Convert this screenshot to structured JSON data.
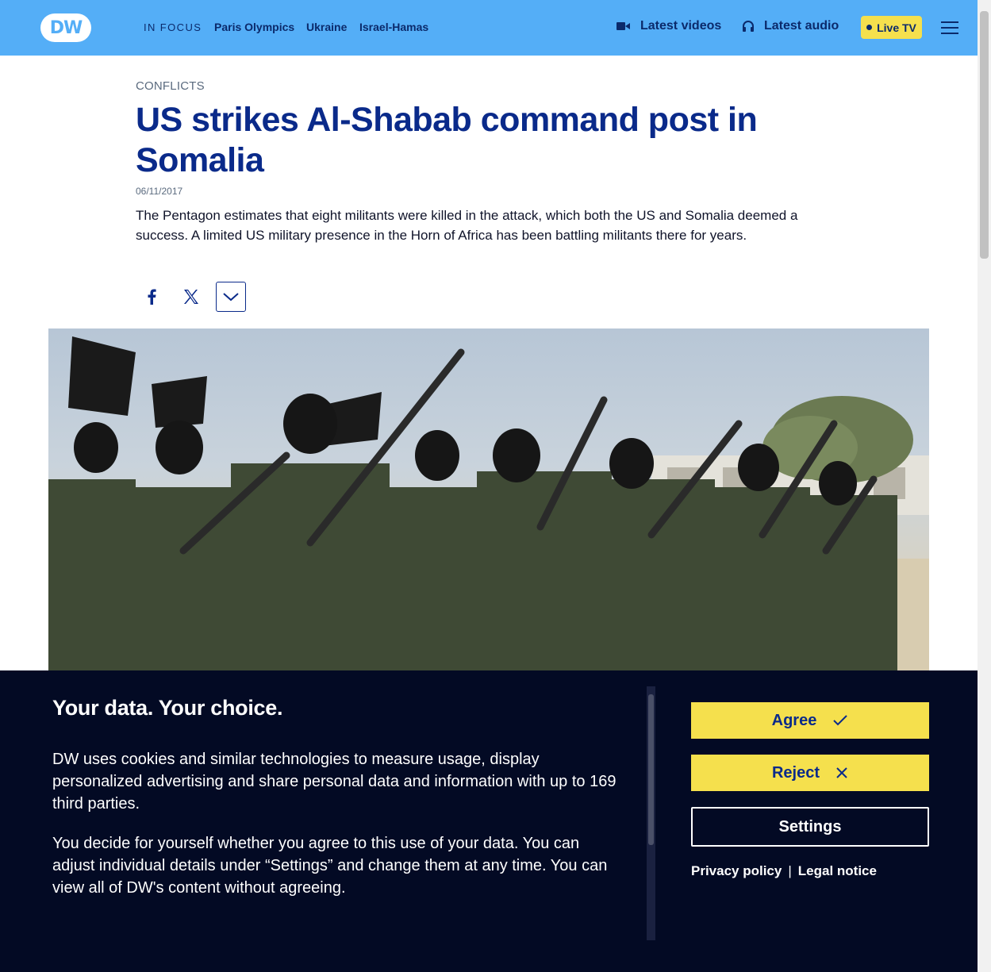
{
  "header": {
    "logo_text": "DW",
    "in_focus_label": "IN FOCUS",
    "focus_links": [
      "Paris Olympics",
      "Ukraine",
      "Israel-Hamas"
    ],
    "latest_videos": "Latest videos",
    "latest_audio": "Latest audio",
    "live_tv": "Live TV",
    "colors": {
      "bar": "#54aef7",
      "text": "#0b2a6b",
      "live_bg": "#f5e04d"
    }
  },
  "article": {
    "category": "CONFLICTS",
    "title": "US strikes Al-Shabab command post in Somalia",
    "date": "06/11/2017",
    "teaser": "The Pentagon estimates that eight militants were killed in the attack, which both the US and Somalia deemed a success. A limited US military presence in the Horn of Africa has been battling militants there for years.",
    "share_icons": [
      "facebook-icon",
      "x-icon",
      "chevron-down-icon"
    ],
    "hero_image": "photo-of-armed-militants-marching"
  },
  "cookie_banner": {
    "title": "Your data. Your choice.",
    "paragraph_1": "DW uses cookies and similar technologies to measure usage, display personalized advertising and share personal data and information with up to 169 third parties.",
    "paragraph_2": "You decide for yourself whether you agree to this use of your data. You can adjust individual details under “Settings” and change them at any time. You can view all of DW's content without agreeing.",
    "agree_label": "Agree",
    "reject_label": "Reject",
    "settings_label": "Settings",
    "privacy_label": "Privacy policy",
    "separator": "|",
    "legal_label": "Legal notice",
    "colors": {
      "bg": "#030a24",
      "button": "#f5e04d",
      "button_text": "#0a2a8a"
    }
  }
}
